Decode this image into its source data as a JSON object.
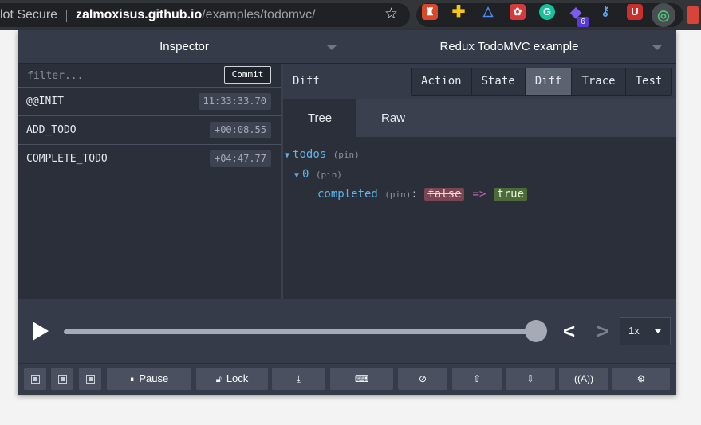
{
  "browser": {
    "security_label": "lot Secure",
    "url_host": "zalmoxisus.github.io",
    "url_path": "/examples/todomvc/",
    "extensions_badge": "6"
  },
  "devtools": {
    "monitor_select": "Inspector",
    "instance_select": "Redux TodoMVC example",
    "filter_placeholder": "filter...",
    "commit_label": "Commit",
    "actions": [
      {
        "name": "@@INIT",
        "time": "11:33:33.70"
      },
      {
        "name": "ADD_TODO",
        "time": "+00:08.55"
      },
      {
        "name": "COMPLETE_TODO",
        "time": "+04:47.77"
      }
    ],
    "diff_title": "Diff",
    "tabs": [
      "Action",
      "State",
      "Diff",
      "Trace",
      "Test"
    ],
    "active_tab": "Diff",
    "subtabs": [
      "Tree",
      "Raw"
    ],
    "active_subtab": "Tree",
    "tree": {
      "root_key": "todos",
      "pin": "(pin)",
      "index_key": "0",
      "field_key": "completed",
      "colon": ":",
      "old_value": "false",
      "arrow": "=>",
      "new_value": "true"
    },
    "slider": {
      "position_fraction": 1.0,
      "speed": "1x"
    },
    "toolbar": {
      "pause_label": "Pause",
      "lock_label": "Lock"
    }
  },
  "colors": {
    "panel_bg": "#2a2f3a",
    "header_bg": "#353b48",
    "key_blue": "#5fb3e6",
    "removed_bg": "#7a4653",
    "added_bg": "#4d6b3a",
    "arrow_pink": "#c06ba8"
  }
}
